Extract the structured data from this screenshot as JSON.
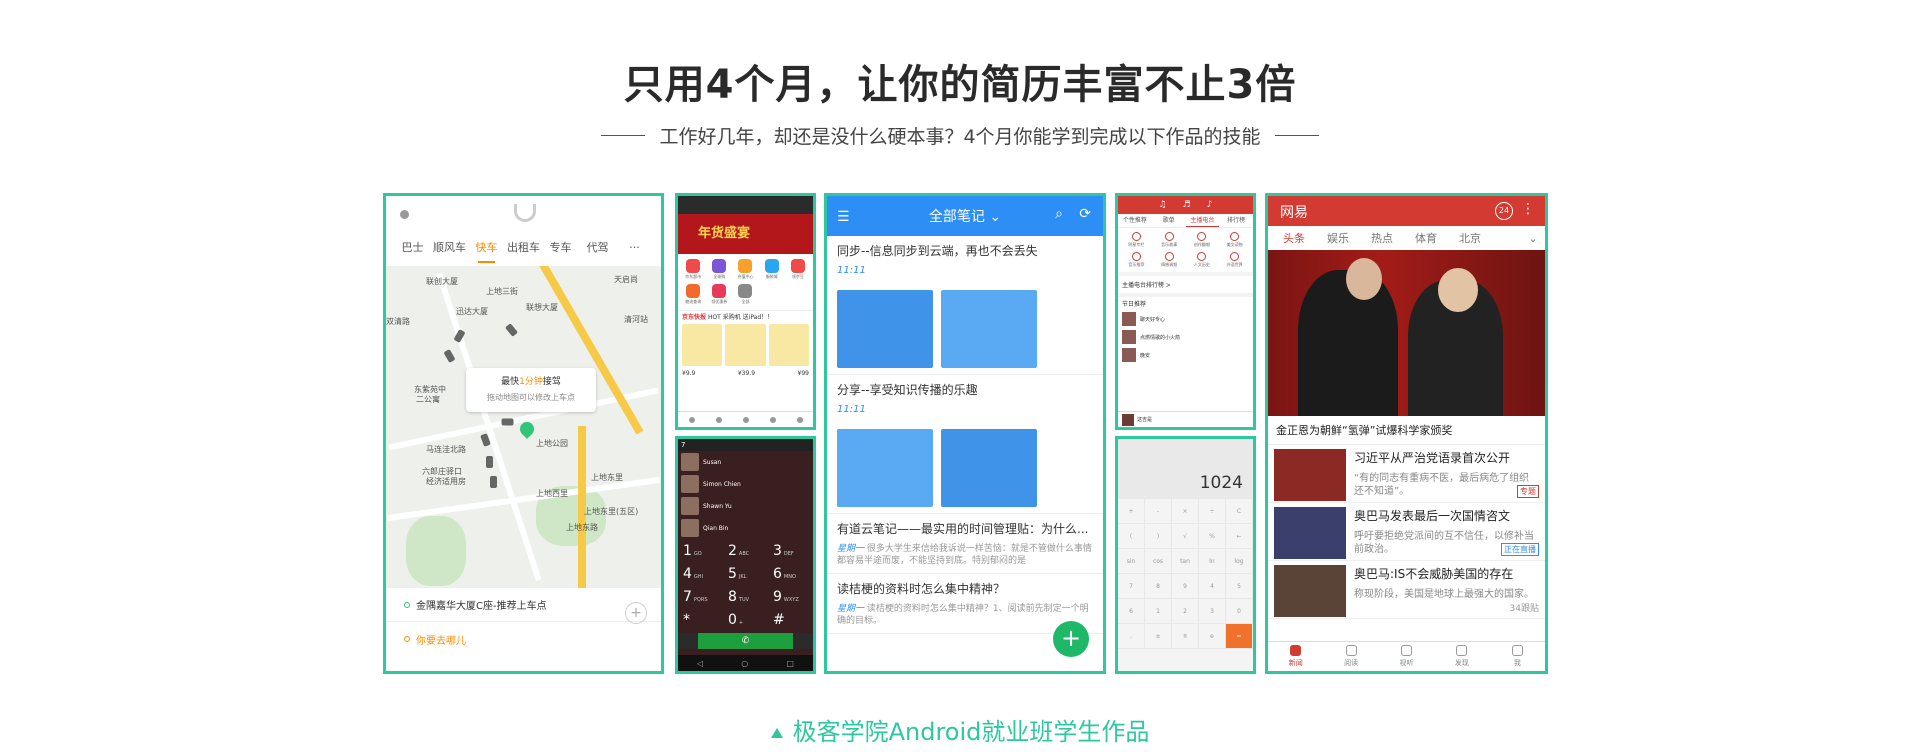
{
  "heading": {
    "title": "只用4个月，让你的简历丰富不止3倍",
    "subtitle": "工作好几年，却还是没什么硬本事？4个月你能学到完成以下作品的技能"
  },
  "caption": "极客学院Android就业班学生作品",
  "colors": {
    "accent": "#2ec7a0",
    "orange": "#ff8a00",
    "red": "#d33a31",
    "blue": "#2d8ef5"
  },
  "ride_app": {
    "tabs": [
      "巴士",
      "顺风车",
      "快车",
      "出租车",
      "专车",
      "代驾",
      "···"
    ],
    "active_tab": "快车",
    "map_labels": [
      "联创大厦",
      "迅达大厦",
      "联想大厦",
      "天启尚",
      "清河站",
      "上地三街",
      "东紫苑中",
      "二公寓",
      "马连洼北路",
      "上地公园",
      "六郎庄驿口",
      "经济适用房",
      "上地东里",
      "上地西里",
      "上地东里(五区)",
      "上地东路",
      "双清路"
    ],
    "bubble_prefix": "最快",
    "bubble_time": "1分钟",
    "bubble_suffix": "接驾",
    "bubble_hint": "拖动地图可以修改上车点",
    "pickup": "金隅嘉华大厦C座-推荐上车点",
    "destination": "你要去哪儿"
  },
  "store_app": {
    "banner": "年货盛宴",
    "icons": [
      "京东超市",
      "全球购",
      "充值中心",
      "服装城",
      "领京豆",
      "物流查询",
      "领优惠券",
      "全部"
    ],
    "news_brand": "京东快报",
    "news": "HOT 采购机 送iPad！！",
    "prices": [
      "¥9.9",
      "¥39.9",
      "¥99"
    ]
  },
  "dialer_app": {
    "status": "7",
    "contacts": [
      "Susan",
      "Simon Chien",
      "Shawn Yu",
      "Qian Bin"
    ],
    "keys": [
      {
        "n": "1",
        "l": "GO"
      },
      {
        "n": "2",
        "l": "ABC"
      },
      {
        "n": "3",
        "l": "DEF"
      },
      {
        "n": "4",
        "l": "GHI"
      },
      {
        "n": "5",
        "l": "JKL"
      },
      {
        "n": "6",
        "l": "MNO"
      },
      {
        "n": "7",
        "l": "PQRS"
      },
      {
        "n": "8",
        "l": "TUV"
      },
      {
        "n": "9",
        "l": "WXYZ"
      },
      {
        "n": "*",
        "l": ""
      },
      {
        "n": "0",
        "l": "+"
      },
      {
        "n": "#",
        "l": ""
      }
    ]
  },
  "note_app": {
    "header": "全部笔记",
    "notes": [
      {
        "title": "同步--信息同步到云端，再也不会丢失",
        "date": "11:11"
      },
      {
        "title": "分享--享受知识传播的乐趣",
        "date": "11:11"
      },
      {
        "title": "有道云笔记——最实用的时间管理贴：为什么...",
        "snippet_day": "星期一",
        "snippet": "很多大学生来信给我诉说一样苦恼：就是不管做什么事情都容易半途而废，不能坚持到底。特别郁闷的是"
      },
      {
        "title": "读桔梗的资料时怎么集中精神？",
        "snippet_day": "星期一",
        "snippet": "读桔梗的资料时怎么集中精神？1、阅读前先制定一个明确的目标。"
      }
    ],
    "fab": "+"
  },
  "music_app": {
    "top": [
      "♫",
      "♬",
      "♪"
    ],
    "tabs": [
      "个性推荐",
      "歌单",
      "主播电台",
      "排行榜"
    ],
    "icons": [
      "明星专栏",
      "音乐故事",
      "创作翻唱",
      "美文读物",
      "音乐推荐",
      "情感调频",
      "人文历史",
      "外语世界"
    ],
    "rank": "主播电台排行榜 >",
    "section": "节日推荐",
    "songs": [
      "聊天好专心",
      "点燃情歌的小火箭",
      "晚安"
    ],
    "player": "这吉是"
  },
  "calculator_app": {
    "display": "1024",
    "keys": [
      "+",
      "-",
      "×",
      "÷",
      "C",
      "(",
      ")",
      "√",
      "%",
      "←",
      "sin",
      "cos",
      "tan",
      "ln",
      "log",
      "7",
      "8",
      "9",
      "4",
      "5",
      "6",
      "1",
      "2",
      "3",
      "0",
      ".",
      "±",
      "π",
      "e",
      "="
    ]
  },
  "news_app": {
    "logo": "网易",
    "badge": "24",
    "tabs": [
      "头条",
      "娱乐",
      "热点",
      "体育",
      "北京"
    ],
    "headline": "金正恩为朝鲜“氢弹”试爆科学家颁奖",
    "items": [
      {
        "title": "习近平从严治党语录首次公开",
        "desc": "“有的同志有重病不医，最后病危了组织还不知道”。",
        "tag": "专题"
      },
      {
        "title": "奥巴马发表最后一次国情咨文",
        "desc": "呼吁要拒绝党派间的互不信任，以修补当前政治。",
        "tag": "正在直播"
      },
      {
        "title": "奥巴马:IS不会威胁美国的存在",
        "desc": "称现阶段，美国是地球上最强大的国家。",
        "comments": "34跟贴"
      }
    ],
    "nav": [
      "新闻",
      "阅读",
      "视听",
      "发现",
      "我"
    ]
  }
}
